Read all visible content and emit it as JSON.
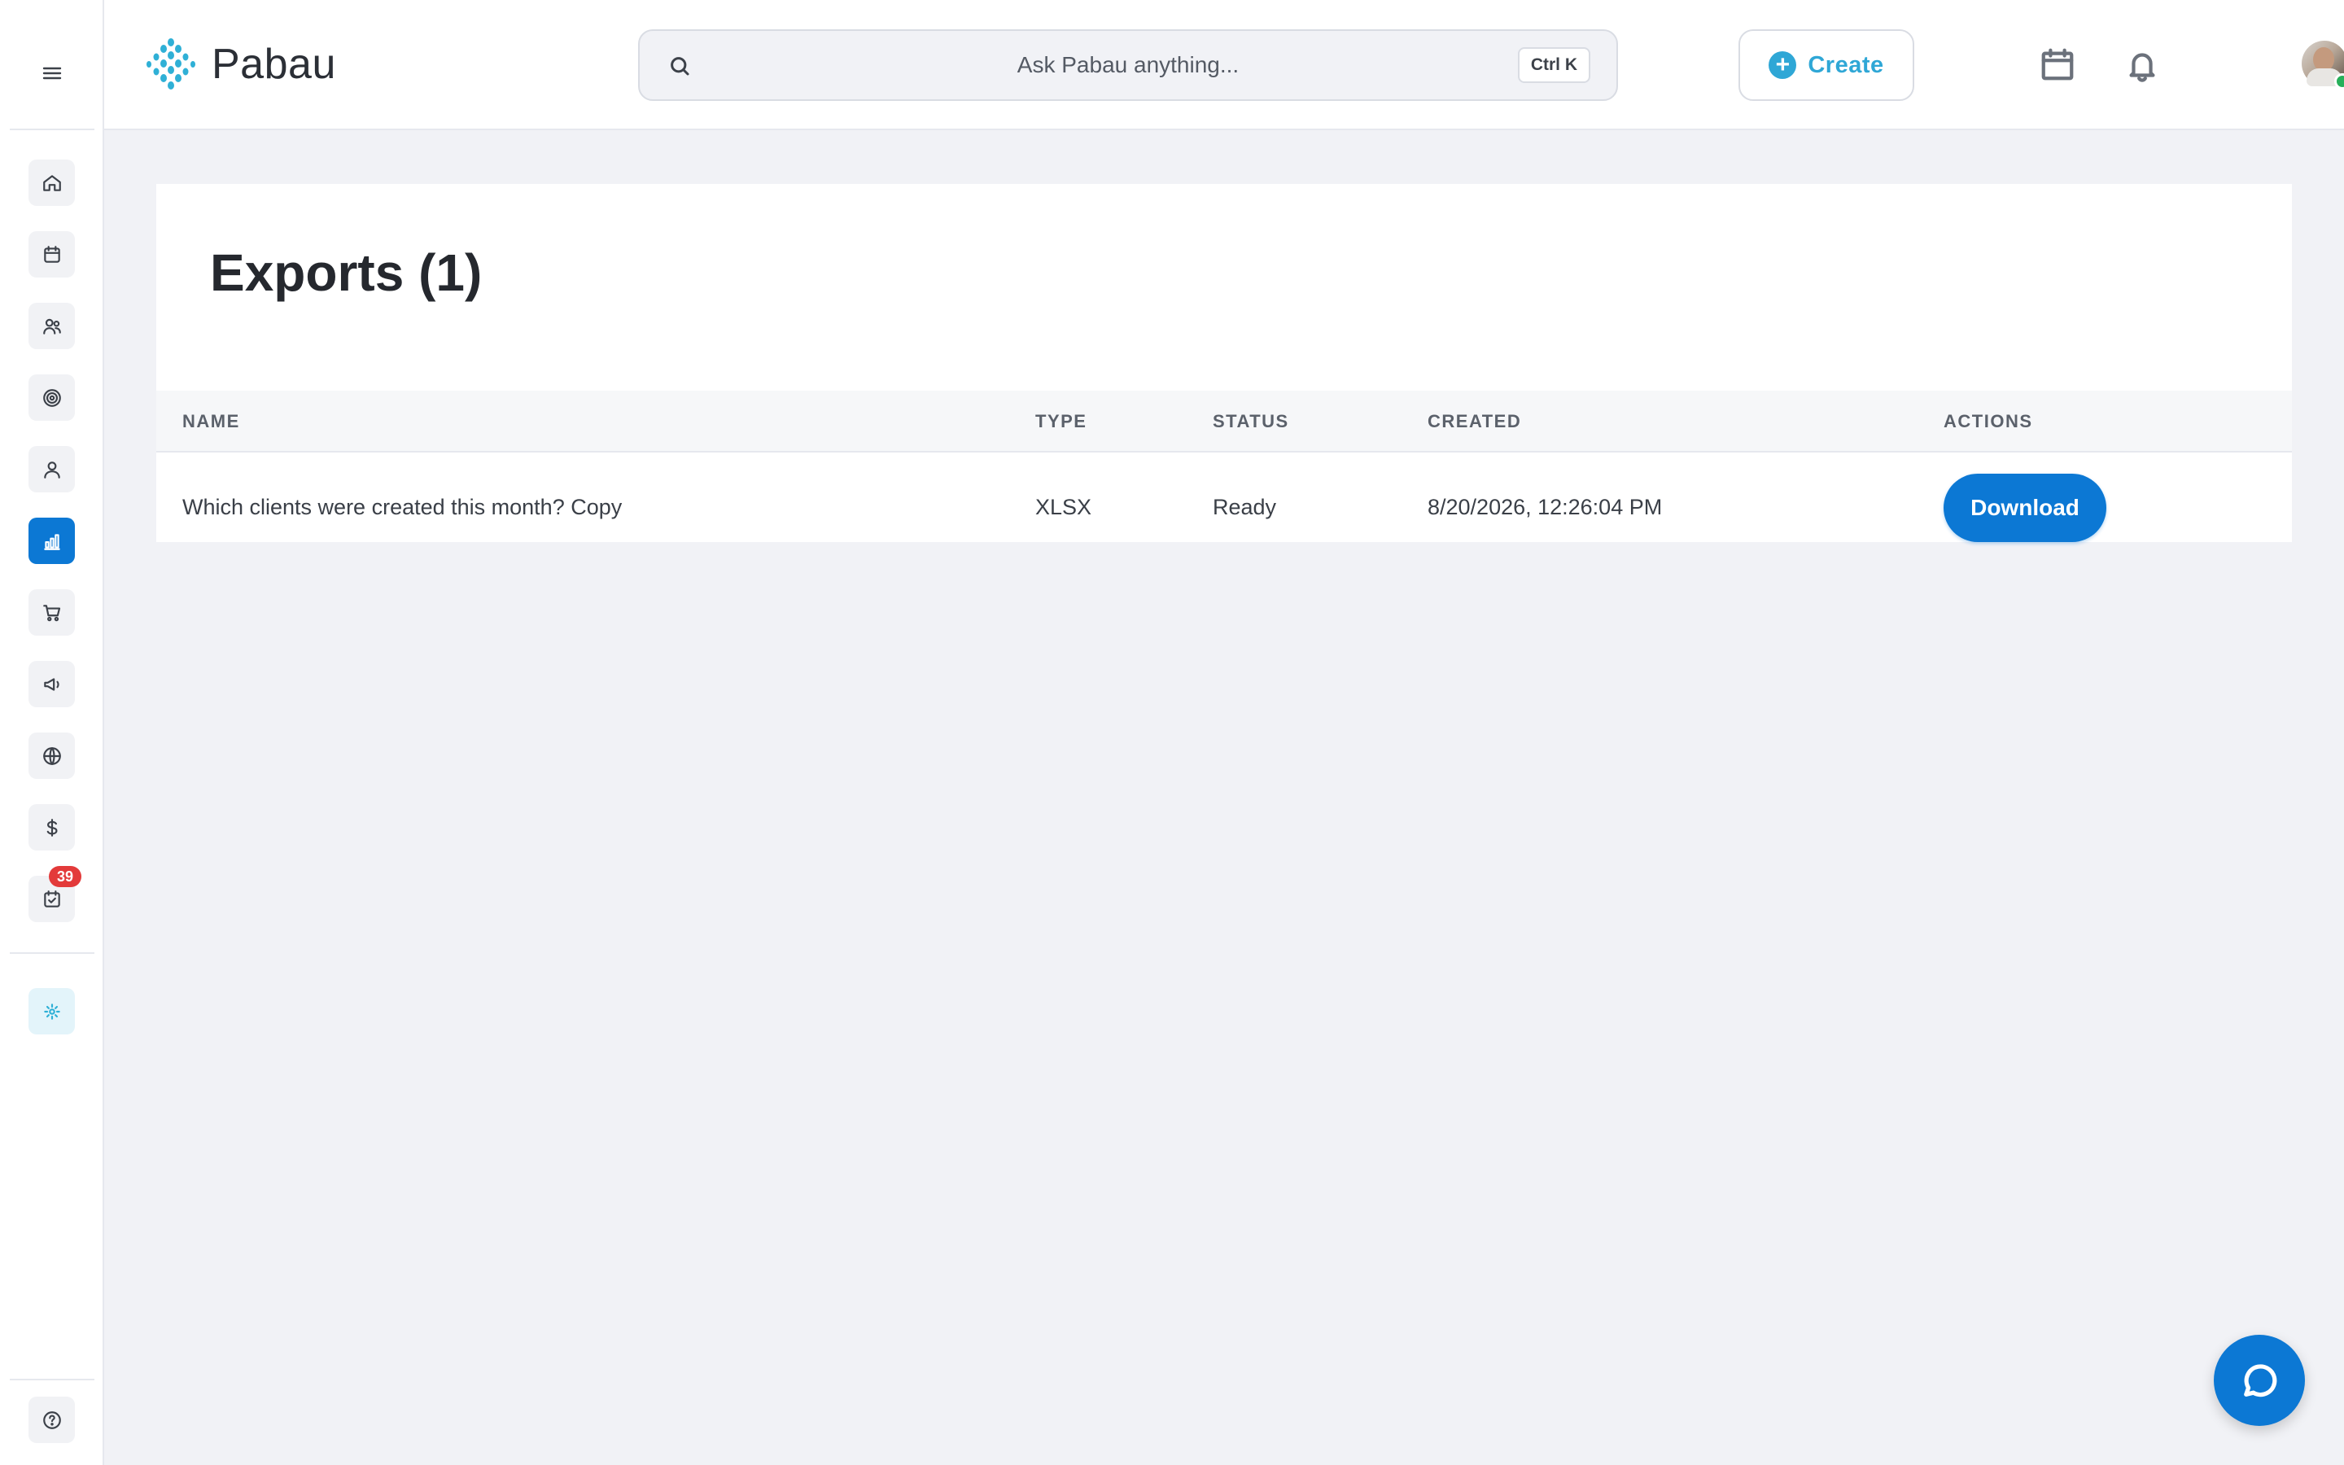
{
  "brand": {
    "name": "Pabau",
    "accent": "#2fa7d6",
    "primary": "#0c78d4"
  },
  "search": {
    "placeholder": "Ask Pabau anything...",
    "shortcut": "Ctrl K"
  },
  "header": {
    "create_label": "Create",
    "icons": [
      "calendar-icon",
      "bell-icon"
    ],
    "user": {
      "online": true
    }
  },
  "sidebar": {
    "items": [
      {
        "icon": "home-icon",
        "active": false
      },
      {
        "icon": "calendar-icon",
        "active": false
      },
      {
        "icon": "clients-icon",
        "active": false
      },
      {
        "icon": "target-icon",
        "active": false
      },
      {
        "icon": "user-icon",
        "active": false
      },
      {
        "icon": "reports-icon",
        "active": true
      },
      {
        "icon": "cart-icon",
        "active": false
      },
      {
        "icon": "megaphone-icon",
        "active": false
      },
      {
        "icon": "globe-icon",
        "active": false
      },
      {
        "icon": "dollar-icon",
        "active": false
      },
      {
        "icon": "tasks-icon",
        "active": false,
        "badge": "39"
      }
    ],
    "ai_item": {
      "icon": "sparkle-icon"
    },
    "help_item": {
      "icon": "help-icon"
    }
  },
  "page": {
    "title": "Exports (1)",
    "table": {
      "columns": [
        "NAME",
        "TYPE",
        "STATUS",
        "CREATED",
        "ACTIONS"
      ],
      "rows": [
        {
          "name": "Which clients were created this month? Copy",
          "type": "XLSX",
          "status": "Ready",
          "created": "8/20/2026, 12:26:04 PM",
          "action_label": "Download"
        }
      ]
    }
  },
  "chat": {
    "icon": "chat-bubble-icon"
  }
}
